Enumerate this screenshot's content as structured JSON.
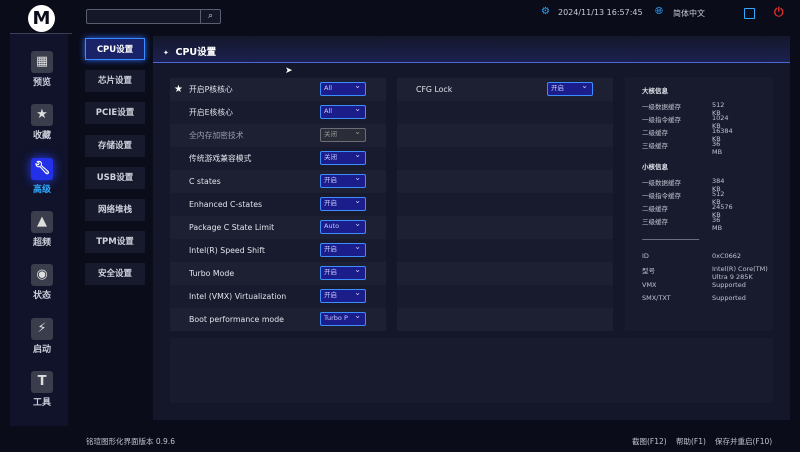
{
  "app": {
    "logo": "M",
    "search": {
      "placeholder": ""
    },
    "datetime": "2024/11/13 16:57:45",
    "language": "简体中文",
    "version": "铭瑄图形化界面版本 0.9.6"
  },
  "colors": {
    "accent": "#3b8cff",
    "power": "#e03030",
    "background": "#0a0c1a"
  },
  "nav": [
    {
      "label": "预览",
      "icon": "grid-icon"
    },
    {
      "label": "收藏",
      "icon": "star-icon"
    },
    {
      "label": "高级",
      "icon": "wrench-icon",
      "active": true
    },
    {
      "label": "超频",
      "icon": "rocket-icon"
    },
    {
      "label": "状态",
      "icon": "eye-icon"
    },
    {
      "label": "启动",
      "icon": "ssd-icon"
    },
    {
      "label": "工具",
      "icon": "hammer-icon"
    }
  ],
  "submenu": [
    {
      "label": "CPU设置",
      "active": true
    },
    {
      "label": "芯片设置"
    },
    {
      "label": "PCIE设置"
    },
    {
      "label": "存储设置"
    },
    {
      "label": "USB设置"
    },
    {
      "label": "网络堆栈"
    },
    {
      "label": "TPM设置"
    },
    {
      "label": "安全设置"
    }
  ],
  "main": {
    "title": "CPU设置",
    "settings": [
      {
        "label": "开启P核核心",
        "value": "All",
        "starred": true
      },
      {
        "label": "开启E核核心",
        "value": "All"
      },
      {
        "label": "全内存加密技术",
        "value": "关闭",
        "disabled": true
      },
      {
        "label": "传统游戏兼容模式",
        "value": "关闭"
      },
      {
        "label": "C states",
        "value": "开启"
      },
      {
        "label": "Enhanced C-states",
        "value": "开启"
      },
      {
        "label": "Package C State Limit",
        "value": "Auto"
      },
      {
        "label": "Intel(R) Speed Shift",
        "value": "开启"
      },
      {
        "label": "Turbo Mode",
        "value": "开启"
      },
      {
        "label": "Intel (VMX) Virtualization",
        "value": "开启"
      },
      {
        "label": "Boot performance mode",
        "value": "Turbo P"
      }
    ],
    "settings2": [
      {
        "label": "CFG Lock",
        "value": "开启"
      }
    ],
    "info": {
      "big_title": "大核信息",
      "big": [
        [
          "一级数据缓存",
          "512 KB"
        ],
        [
          "一级指令缓存",
          "1024 KB"
        ],
        [
          "二级缓存",
          "16384 KB"
        ],
        [
          "三级缓存",
          "36 MB"
        ]
      ],
      "small_title": "小核信息",
      "small": [
        [
          "一级数据缓存",
          "384 KB"
        ],
        [
          "一级指令缓存",
          "512 KB"
        ],
        [
          "二级缓存",
          "24576 KB"
        ],
        [
          "三级缓存",
          "36 MB"
        ]
      ],
      "divider": "------------------------------------------",
      "cpu": [
        [
          "ID",
          "0xC0662"
        ],
        [
          "型号",
          "Intel(R) Core(TM) Ultra 9 285K"
        ],
        [
          "VMX",
          "Supported"
        ],
        [
          "SMX/TXT",
          "Supported"
        ]
      ]
    }
  },
  "footer": {
    "screenshot": "截图(F12)",
    "help": "帮助(F1)",
    "save_restart": "保存并重启(F10)"
  }
}
